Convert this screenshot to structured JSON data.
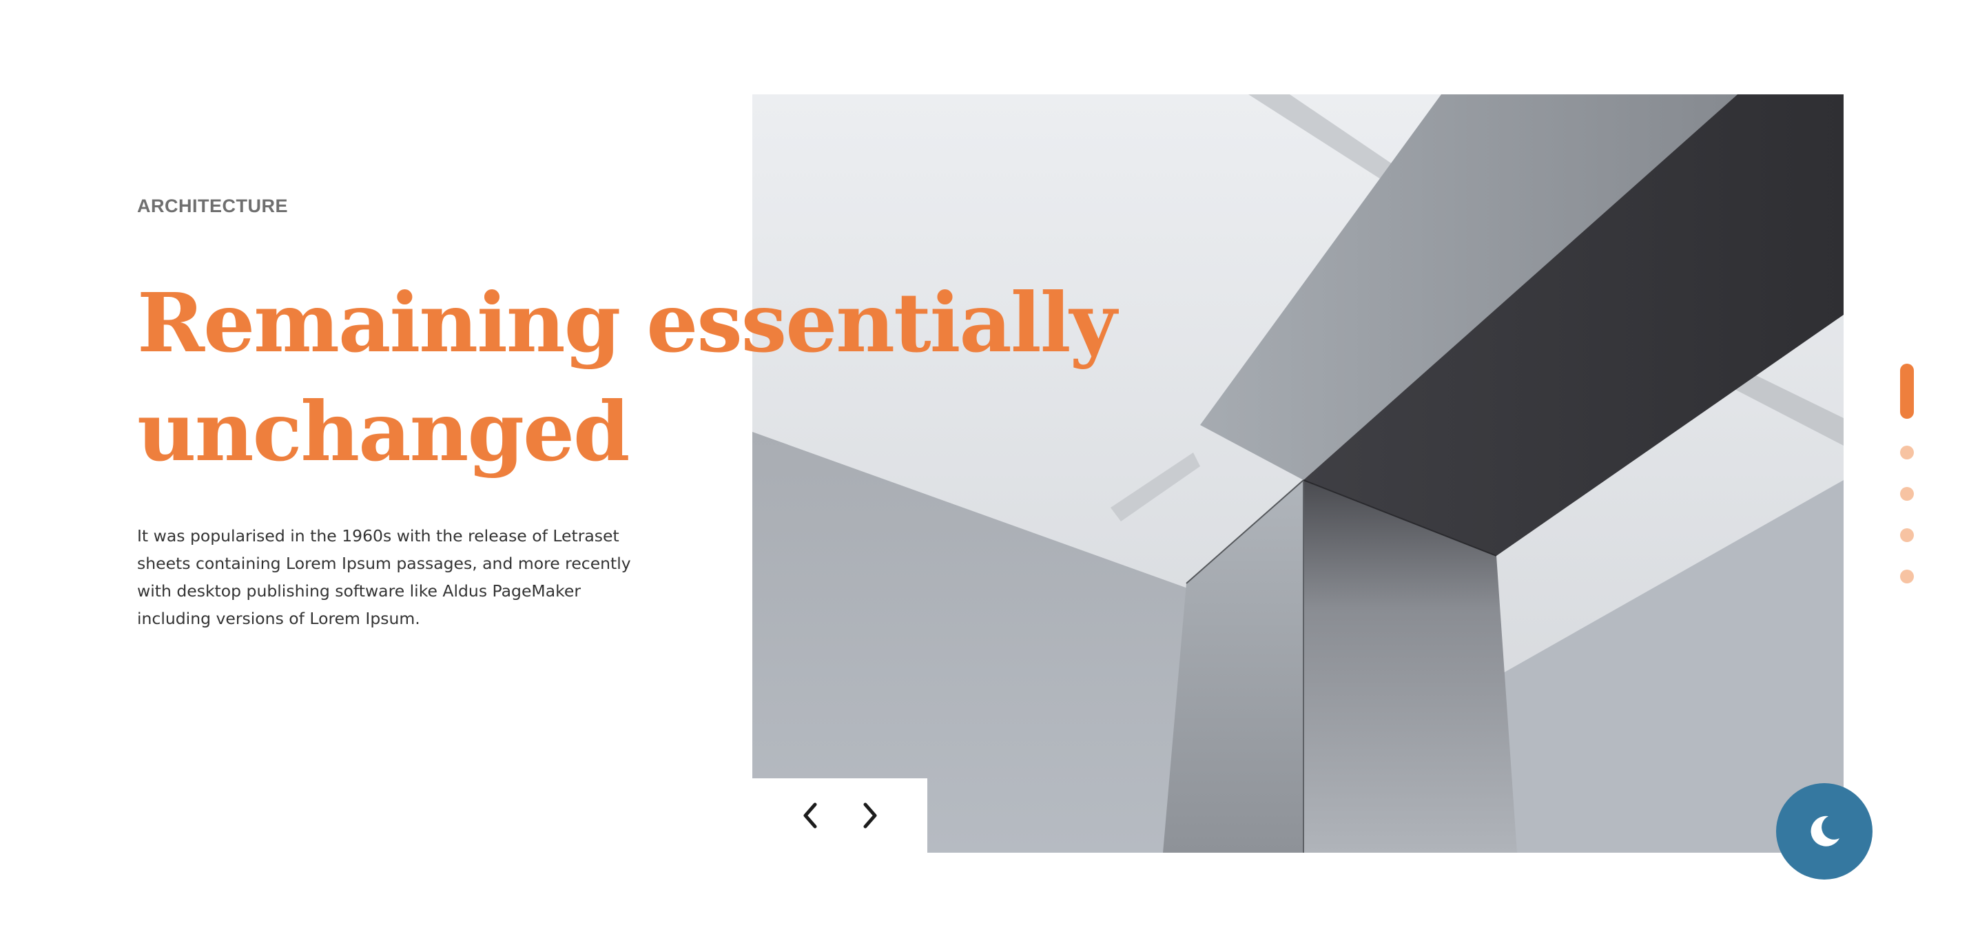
{
  "slide": {
    "category": "ARCHITECTURE",
    "title_line1": "Remaining essentially",
    "title_line2": "unchanged",
    "description_lines": [
      "It was popularised in the 1960s with the release of Letraset",
      "sheets containing Lorem Ipsum passages, and more recently",
      "with desktop publishing software like Aldus PageMaker",
      "including versions of Lorem Ipsum."
    ],
    "image_icon": "architecture-photo"
  },
  "navigation": {
    "prev_icon": "chevron-left-icon",
    "next_icon": "chevron-right-icon"
  },
  "pagination": {
    "total": 5,
    "active_index": 0
  },
  "theme_toggle": {
    "icon": "moon-icon"
  },
  "colors": {
    "accent": "#ee7f3d",
    "accent_light": "#f7c3a2",
    "toggle": "#3578a0",
    "category_text": "#6f6f6f",
    "body_text": "#333333"
  }
}
